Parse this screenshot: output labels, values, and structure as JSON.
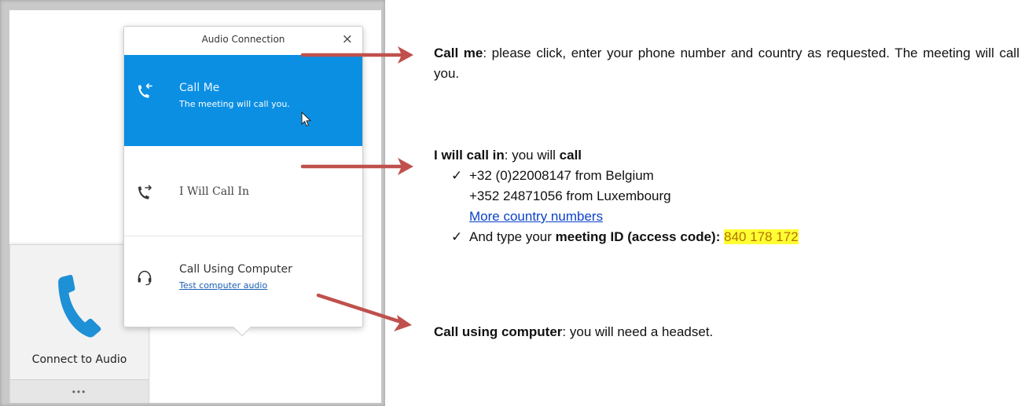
{
  "popup": {
    "title": "Audio Connection",
    "close_glyph": "×",
    "options": [
      {
        "title": "Call Me",
        "subtitle": "The meeting will call you.",
        "icon": "call-me-icon"
      },
      {
        "title": "I Will Call In",
        "icon": "call-in-icon"
      },
      {
        "title": "Call Using Computer",
        "subtitle": "Test computer audio",
        "icon": "headset-icon"
      }
    ]
  },
  "tile": {
    "label": "Connect to Audio",
    "more": "•••",
    "icon": "phone-icon"
  },
  "notes": {
    "callme": {
      "term": "Call me",
      "text": ": please click, enter your phone number and country as requested. The meeting will call you."
    },
    "callin": {
      "term": "I will call in",
      "text": ": you will ",
      "bold": "call",
      "check": "✓",
      "numbers": [
        "+32 (0)22008147 from Belgium",
        "+352 24871056 from Luxembourg"
      ],
      "link": "More country numbers",
      "id_prefix": "And type your ",
      "id_label": "meeting ID (access code):",
      "id_value": "840 178 172"
    },
    "computer": {
      "term": "Call using computer",
      "text": ": you will need a headset."
    }
  },
  "colors": {
    "accent": "#0b8fe3",
    "arrow": "#c0504d",
    "highlight": "#ffff33"
  }
}
